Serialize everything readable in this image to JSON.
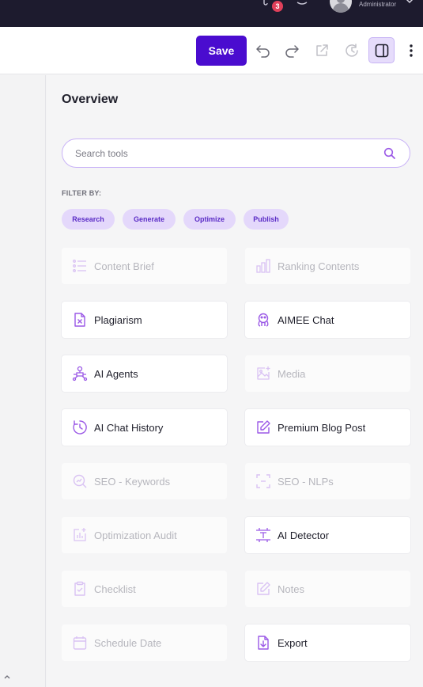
{
  "topbar": {
    "notification_count": "3",
    "user_role": "Administrator",
    "icons": [
      "help-icon",
      "bell-icon",
      "avatar",
      "chevron-down-icon"
    ]
  },
  "toolbar": {
    "save_label": "Save",
    "icons": [
      "undo-icon",
      "redo-icon",
      "external-link-icon",
      "history-icon",
      "panel-toggle-icon",
      "more-vertical-icon"
    ]
  },
  "panel": {
    "title": "Overview",
    "search_placeholder": "Search tools",
    "filter_label": "FILTER BY:",
    "filters": [
      "Research",
      "Generate",
      "Optimize",
      "Publish"
    ]
  },
  "tools": [
    {
      "label": "Content Brief",
      "icon": "list-icon",
      "enabled": false
    },
    {
      "label": "Ranking Contents",
      "icon": "bar-chart-icon",
      "enabled": false
    },
    {
      "label": "Plagiarism",
      "icon": "file-x-icon",
      "enabled": true
    },
    {
      "label": "AIMEE Chat",
      "icon": "bot-icon",
      "enabled": true
    },
    {
      "label": "AI Agents",
      "icon": "agents-icon",
      "enabled": true
    },
    {
      "label": "Media",
      "icon": "image-plus-icon",
      "enabled": false
    },
    {
      "label": "AI Chat History",
      "icon": "clock-icon",
      "enabled": true
    },
    {
      "label": "Premium Blog Post",
      "icon": "edit-icon",
      "enabled": true
    },
    {
      "label": "SEO - Keywords",
      "icon": "search-chart-icon",
      "enabled": false
    },
    {
      "label": "SEO - NLPs",
      "icon": "scan-icon",
      "enabled": false
    },
    {
      "label": "Optimization Audit",
      "icon": "audit-icon",
      "enabled": false
    },
    {
      "label": "AI Detector",
      "icon": "detector-icon",
      "enabled": true
    },
    {
      "label": "Checklist",
      "icon": "clipboard-check-icon",
      "enabled": false
    },
    {
      "label": "Notes",
      "icon": "pencil-icon",
      "enabled": false
    },
    {
      "label": "Schedule Date",
      "icon": "calendar-icon",
      "enabled": false
    },
    {
      "label": "Export",
      "icon": "file-download-icon",
      "enabled": true
    }
  ],
  "colors": {
    "topbar_bg": "#1d1b2e",
    "primary": "#4a0ccf",
    "accent": "#9b59e6",
    "chip_bg": "#e4d8fb",
    "badge": "#e0405a"
  }
}
